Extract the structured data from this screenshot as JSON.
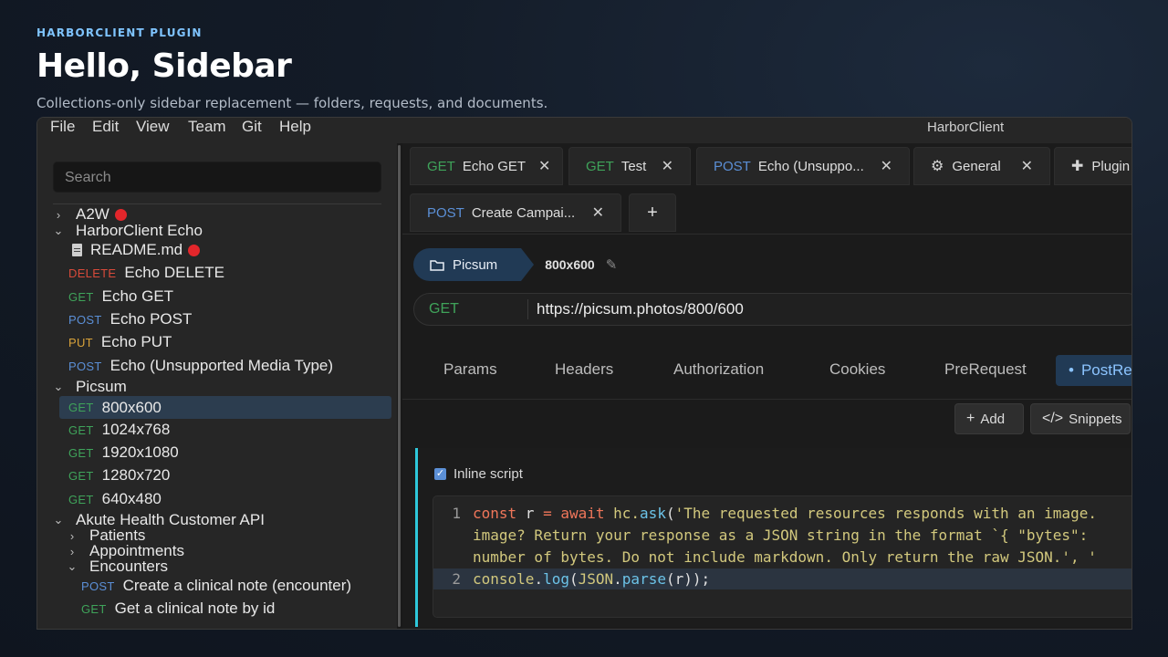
{
  "header": {
    "eyebrow": "HARBORCLIENT PLUGIN",
    "title": "Hello, Sidebar",
    "subtitle": "Collections-only sidebar replacement — folders, requests, and documents."
  },
  "menu": [
    "File",
    "Edit",
    "View",
    "Team",
    "Git",
    "Help"
  ],
  "app_title": "HarborClient",
  "sidebar": {
    "search_placeholder": "Search",
    "items": [
      {
        "label": "A2W"
      },
      {
        "label": "HarborClient Echo"
      },
      {
        "label": "README.md"
      },
      {
        "method": "DELETE",
        "label": "Echo DELETE"
      },
      {
        "method": "GET",
        "label": "Echo GET"
      },
      {
        "method": "POST",
        "label": "Echo POST"
      },
      {
        "method": "PUT",
        "label": "Echo PUT"
      },
      {
        "method": "POST",
        "label": "Echo (Unsupported Media Type)"
      },
      {
        "label": "Picsum"
      },
      {
        "method": "GET",
        "label": "800x600"
      },
      {
        "method": "GET",
        "label": "1024x768"
      },
      {
        "method": "GET",
        "label": "1920x1080"
      },
      {
        "method": "GET",
        "label": "1280x720"
      },
      {
        "method": "GET",
        "label": "640x480"
      },
      {
        "label": "Akute Health Customer API"
      },
      {
        "label": "Patients"
      },
      {
        "label": "Appointments"
      },
      {
        "label": "Encounters"
      },
      {
        "method": "POST",
        "label": "Create a clinical note (encounter)"
      },
      {
        "method": "GET",
        "label": "Get a clinical note by id"
      }
    ]
  },
  "tabs": [
    {
      "method": "GET",
      "label": "Echo GET"
    },
    {
      "method": "GET",
      "label": "Test"
    },
    {
      "method": "POST",
      "label": "Echo (Unsuppo..."
    },
    {
      "label": "General"
    },
    {
      "label": "Plugin"
    },
    {
      "method": "POST",
      "label": "Create Campai..."
    }
  ],
  "add_tab_label": "+",
  "breadcrumb": {
    "folder": "Picsum",
    "current": "800x600"
  },
  "url": {
    "method": "GET",
    "value": "https://picsum.photos/800/600"
  },
  "request_tabs": [
    "Params",
    "Headers",
    "Authorization",
    "Cookies",
    "PreRequest",
    "PostRe"
  ],
  "buttons": {
    "add": "Add",
    "snippets": "Snippets"
  },
  "script": {
    "checkbox_label": "Inline script",
    "line_numbers": [
      "1",
      "2"
    ],
    "line1_kw1": "const",
    "line1_var": " r ",
    "line1_eq": "= ",
    "line1_kw2": "await",
    "line1_obj": " hc.",
    "line1_fn": "ask",
    "line1_paren": "(",
    "line1_str": "'The requested resources responds with an image.",
    "line1b": "image? Return your response as a JSON string in the format `{ \"bytes\":",
    "line1c_a": "number of bytes. Do not include markdown. Only return the raw JSON.'",
    "line1c_b": ", '",
    "line2_obj": "console",
    "line2_dot": ".",
    "line2_fn": "log",
    "line2_p1": "(",
    "line2_obj2": "JSON",
    "line2_dot2": ".",
    "line2_fn2": "parse",
    "line2_rest": "(r));"
  },
  "colors": {
    "get": "#3fa35a",
    "post": "#5b8fd6",
    "put": "#d8a23a",
    "delete": "#d84a3a",
    "accent": "#2ec8da"
  }
}
